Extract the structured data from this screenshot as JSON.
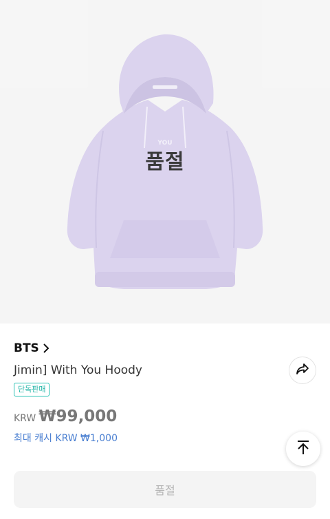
{
  "product": {
    "image_alt": "lavender hoodie",
    "soldout_overlay": "품절",
    "chest_print": "YOU",
    "artist": "BTS",
    "title": "Jimin] With You Hoody",
    "badge": "단독판매",
    "price_currency": "KRW",
    "price_value": "₩99,000",
    "cash": "최대 캐시 KRW ₩1,000"
  },
  "actions": {
    "share_icon": "share-icon",
    "top_icon": "arrow-up-to-top-icon",
    "buy_label": "품절"
  },
  "colors": {
    "hoodie": "#c9bde6",
    "badge": "#27c1b3",
    "cash": "#4a7fd1"
  }
}
